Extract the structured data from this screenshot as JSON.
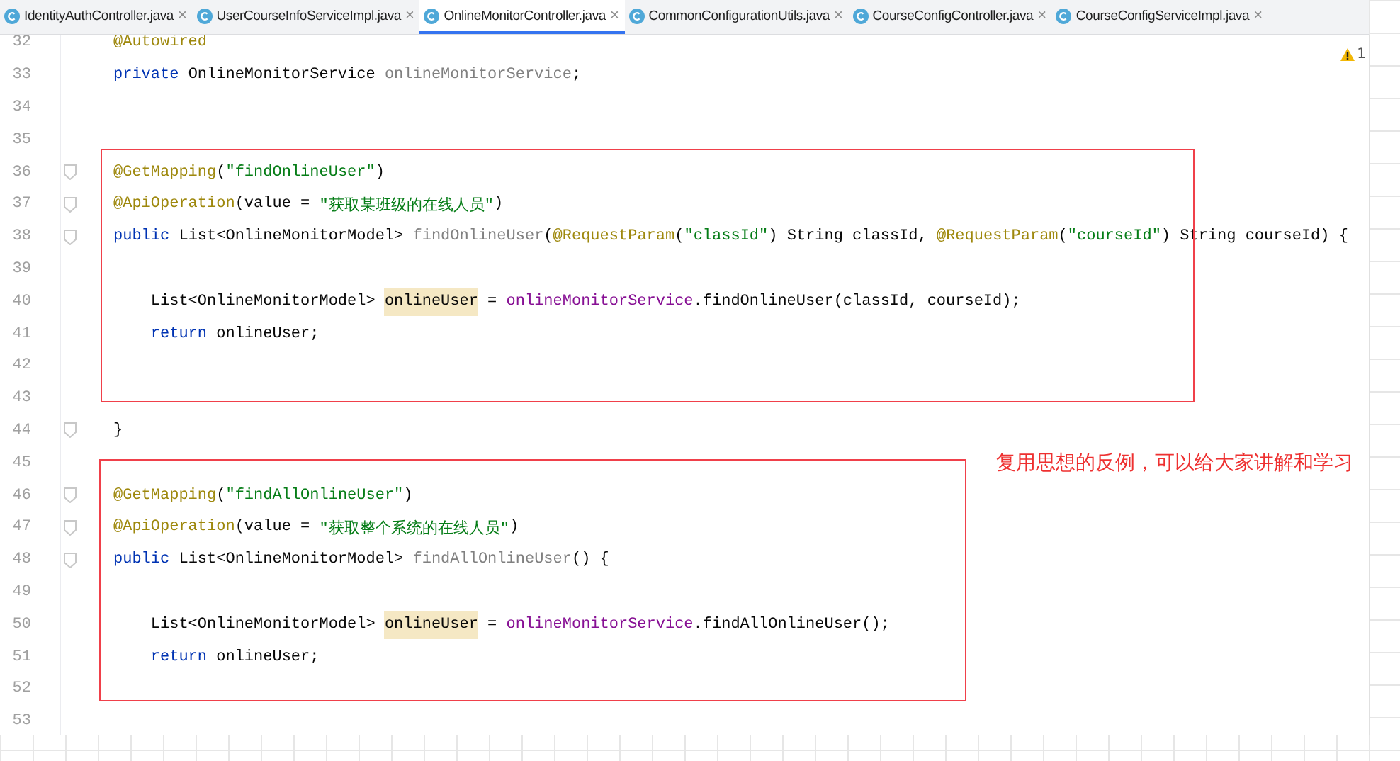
{
  "tabs": [
    {
      "label": "IdentityAuthController.java",
      "close": "×",
      "selected": false
    },
    {
      "label": "UserCourseInfoServiceImpl.java",
      "close": "×",
      "selected": false
    },
    {
      "label": "OnlineMonitorController.java",
      "close": "×",
      "selected": true
    },
    {
      "label": "CommonConfigurationUtils.java",
      "close": "×",
      "selected": false
    },
    {
      "label": "CourseConfigController.java",
      "close": "×",
      "selected": false
    },
    {
      "label": "CourseConfigServiceImpl.java",
      "close": "×",
      "selected": false
    }
  ],
  "inspection": {
    "count": "1"
  },
  "lines": [
    {
      "number": "32",
      "fold": false,
      "tokens": [
        {
          "kind": "annotation",
          "text": "@Autowired"
        }
      ]
    },
    {
      "number": "33",
      "fold": false,
      "tokens": [
        {
          "kind": "keyword",
          "text": "private "
        },
        {
          "kind": "plain",
          "text": "OnlineMonitorService "
        },
        {
          "kind": "unused",
          "text": "onlineMonitorService"
        },
        {
          "kind": "plain",
          "text": ";"
        }
      ]
    },
    {
      "number": "34",
      "fold": false
    },
    {
      "number": "35",
      "fold": false
    },
    {
      "number": "36",
      "fold": true,
      "tokens": [
        {
          "kind": "annotation",
          "text": "@GetMapping"
        },
        {
          "kind": "plain",
          "text": "("
        },
        {
          "kind": "string",
          "text": "\"findOnlineUser\""
        },
        {
          "kind": "plain",
          "text": ")"
        }
      ]
    },
    {
      "number": "37",
      "fold": true,
      "tokens": [
        {
          "kind": "annotation",
          "text": "@ApiOperation"
        },
        {
          "kind": "plain",
          "text": "(value = "
        },
        {
          "kind": "string",
          "text": "\"获取某班级的在线人员\""
        },
        {
          "kind": "plain",
          "text": ")"
        }
      ]
    },
    {
      "number": "38",
      "fold": true,
      "tokens": [
        {
          "kind": "keyword",
          "text": "public "
        },
        {
          "kind": "plain",
          "text": "List<OnlineMonitorModel> "
        },
        {
          "kind": "unused",
          "text": "findOnlineUser"
        },
        {
          "kind": "plain",
          "text": "("
        },
        {
          "kind": "annotation",
          "text": "@RequestParam"
        },
        {
          "kind": "plain",
          "text": "("
        },
        {
          "kind": "string",
          "text": "\"classId\""
        },
        {
          "kind": "plain",
          "text": ") String classId, "
        },
        {
          "kind": "annotation",
          "text": "@RequestParam"
        },
        {
          "kind": "plain",
          "text": "("
        },
        {
          "kind": "string",
          "text": "\"courseId\""
        },
        {
          "kind": "plain",
          "text": ") String courseId) {"
        }
      ]
    },
    {
      "number": "39",
      "fold": false
    },
    {
      "number": "40",
      "fold": false,
      "tokens": [
        {
          "kind": "plain",
          "text": "    List<OnlineMonitorModel> "
        },
        {
          "kind": "highlight",
          "text": "onlineUser"
        },
        {
          "kind": "plain",
          "text": " = "
        },
        {
          "kind": "field",
          "text": "onlineMonitorService"
        },
        {
          "kind": "plain",
          "text": ".findOnlineUser(classId, courseId);"
        }
      ]
    },
    {
      "number": "41",
      "fold": false,
      "tokens": [
        {
          "kind": "keyword",
          "text": "    return "
        },
        {
          "kind": "plain",
          "text": "onlineUser;"
        }
      ]
    },
    {
      "number": "42",
      "fold": false
    },
    {
      "number": "43",
      "fold": false
    },
    {
      "number": "44",
      "fold": true,
      "tokens": [
        {
          "kind": "plain",
          "text": "}"
        }
      ]
    },
    {
      "number": "45",
      "fold": false
    },
    {
      "number": "46",
      "fold": true,
      "tokens": [
        {
          "kind": "annotation",
          "text": "@GetMapping"
        },
        {
          "kind": "plain",
          "text": "("
        },
        {
          "kind": "string",
          "text": "\"findAllOnlineUser\""
        },
        {
          "kind": "plain",
          "text": ")"
        }
      ]
    },
    {
      "number": "47",
      "fold": true,
      "tokens": [
        {
          "kind": "annotation",
          "text": "@ApiOperation"
        },
        {
          "kind": "plain",
          "text": "(value = "
        },
        {
          "kind": "string",
          "text": "\"获取整个系统的在线人员\""
        },
        {
          "kind": "plain",
          "text": ")"
        }
      ]
    },
    {
      "number": "48",
      "fold": true,
      "tokens": [
        {
          "kind": "keyword",
          "text": "public "
        },
        {
          "kind": "plain",
          "text": "List<OnlineMonitorModel> "
        },
        {
          "kind": "unused",
          "text": "findAllOnlineUser"
        },
        {
          "kind": "plain",
          "text": "() {"
        }
      ]
    },
    {
      "number": "49",
      "fold": false
    },
    {
      "number": "50",
      "fold": false,
      "tokens": [
        {
          "kind": "plain",
          "text": "    List<OnlineMonitorModel> "
        },
        {
          "kind": "highlight",
          "text": "onlineUser"
        },
        {
          "kind": "plain",
          "text": " = "
        },
        {
          "kind": "field",
          "text": "onlineMonitorService"
        },
        {
          "kind": "plain",
          "text": ".findAllOnlineUser();"
        }
      ]
    },
    {
      "number": "51",
      "fold": false,
      "tokens": [
        {
          "kind": "keyword",
          "text": "    return "
        },
        {
          "kind": "plain",
          "text": "onlineUser;"
        }
      ]
    },
    {
      "number": "52",
      "fold": false
    },
    {
      "number": "53",
      "fold": false
    }
  ],
  "note": "复用思想的反例，可以给大家讲解和学习"
}
